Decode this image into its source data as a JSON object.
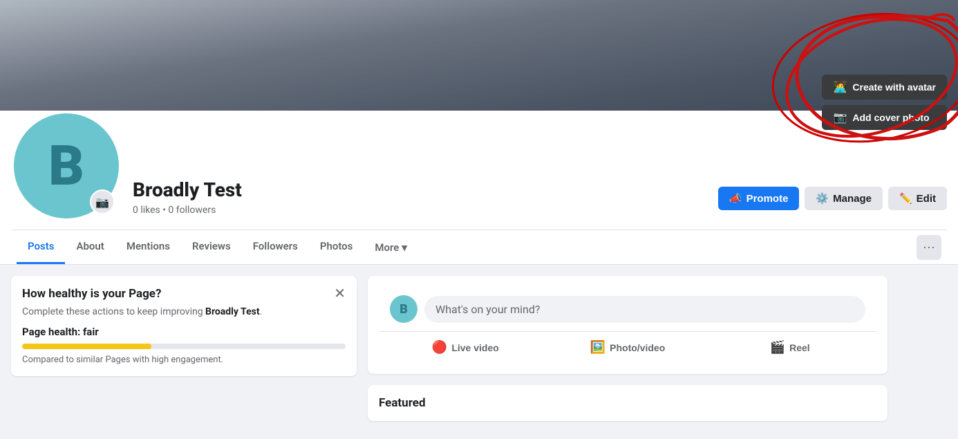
{
  "cover": {
    "create_avatar_label": "Create with avatar",
    "add_cover_label": "Add cover photo"
  },
  "profile": {
    "page_name": "Broadly Test",
    "stats": "0 likes • 0 followers",
    "avatar_letter": "B",
    "promote_label": "Promote",
    "manage_label": "Manage",
    "edit_label": "Edit"
  },
  "nav": {
    "tabs": [
      {
        "id": "posts",
        "label": "Posts",
        "active": true
      },
      {
        "id": "about",
        "label": "About",
        "active": false
      },
      {
        "id": "mentions",
        "label": "Mentions",
        "active": false
      },
      {
        "id": "reviews",
        "label": "Reviews",
        "active": false
      },
      {
        "id": "followers",
        "label": "Followers",
        "active": false
      },
      {
        "id": "photos",
        "label": "Photos",
        "active": false
      }
    ],
    "more_label": "More",
    "dots_label": "···"
  },
  "page_health": {
    "title": "How healthy is your Page?",
    "description_prefix": "Complete these actions to keep improving ",
    "description_page": "Broadly Test",
    "description_suffix": ".",
    "health_label": "Page health: fair",
    "health_bar_width": "40%",
    "comparison_text": "Compared to similar Pages with high engagement."
  },
  "post_box": {
    "placeholder": "What's on your mind?",
    "avatar_letter": "B",
    "live_video_label": "Live video",
    "photo_video_label": "Photo/video",
    "reel_label": "Reel"
  },
  "featured": {
    "title": "Featured"
  }
}
